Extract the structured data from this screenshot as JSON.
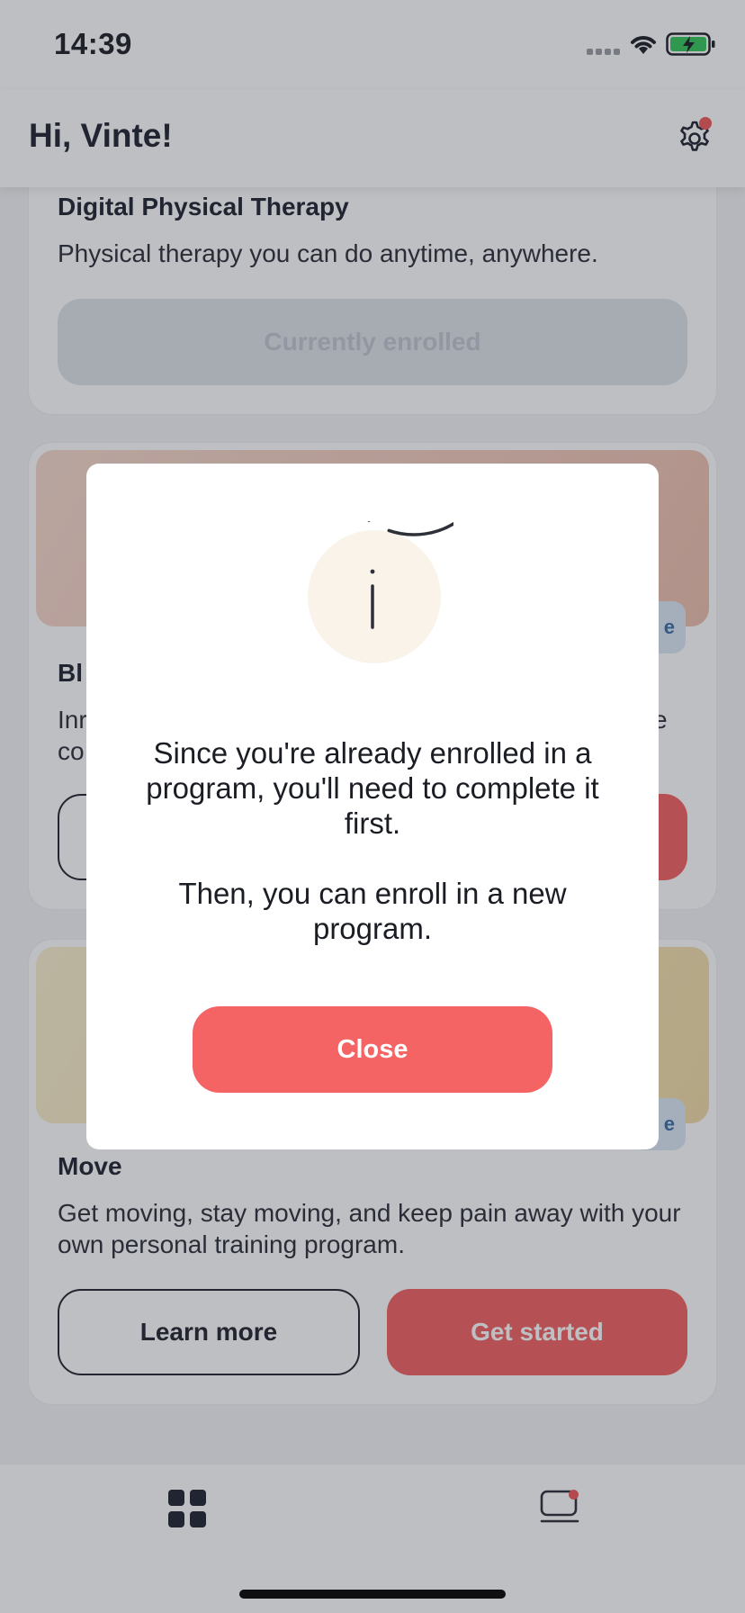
{
  "status_bar": {
    "time": "14:39"
  },
  "header": {
    "greeting": "Hi, Vinte!"
  },
  "cards": [
    {
      "title": "Digital Physical Therapy",
      "description": "Physical therapy you can do anytime, anywhere.",
      "button": "Currently enrolled"
    },
    {
      "title_visible": "Bl",
      "desc_line1_visible": "Inr",
      "desc_line2_visible": "co",
      "desc_tail_visible": "e",
      "tag_visible": "e"
    },
    {
      "title": "Move",
      "description": "Get moving, stay moving, and keep pain away with your own personal training program.",
      "tag_visible": "e",
      "learn_more": "Learn more",
      "get_started": "Get started"
    }
  ],
  "dialog": {
    "icon": "info-icon",
    "message_1": "Since you're already enrolled in a program, you'll need to complete it first.",
    "message_2": "Then, you can enroll in a new program.",
    "close_label": "Close"
  },
  "tabbar": {
    "items": [
      "grid-icon",
      "messages-icon"
    ]
  },
  "colors": {
    "accent": "#f46464",
    "tag_bg": "#dbe8f5",
    "text": "#1f2230"
  }
}
